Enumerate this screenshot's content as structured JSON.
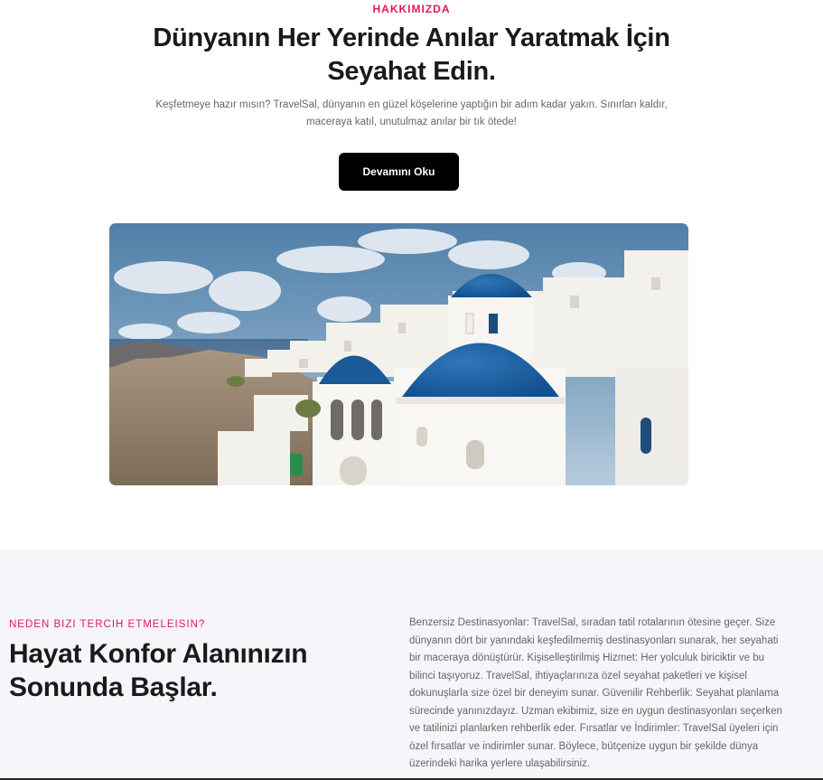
{
  "about": {
    "eyebrow": "HAKKIMIZDA",
    "headline": "Dünyanın Her Yerinde Anılar Yaratmak İçin Seyahat Edin.",
    "description": "Keşfetmeye hazır mısın? TravelSal, dünyanın en güzel köşelerine yaptığın bir adım kadar yakın. Sınırları kaldır, maceraya katıl, unutulmaz anılar bir tık ötede!",
    "cta_label": "Devamını Oku",
    "hero_icon": "santorini-photo"
  },
  "why": {
    "eyebrow": "NEDEN BIZI TERCIH ETMELEISIN?",
    "title": "Hayat Konfor Alanınızın Sonunda Başlar.",
    "body": "Benzersiz Destinasyonlar: TravelSal, sıradan tatil rotalarının ötesine geçer. Size dünyanın dört bir yanındaki keşfedilmemiş destinasyonları sunarak, her seyahati bir maceraya dönüştürür. Kişiselleştirilmiş Hizmet: Her yolculuk biriciktir ve bu bilinci taşıyoruz. TravelSal, ihtiyaçlarınıza özel seyahat paketleri ve kişisel dokunuşlarla size özel bir deneyim sunar. Güvenilir Rehberlik: Seyahat planlama sürecinde yanınızdayız. Uzman ekibimiz, size en uygun destinasyonları seçerken ve tatilinizi planlarken rehberlik eder. Fırsatlar ve İndirimler: TravelSal üyeleri için özel fırsatlar ve indirimler sunar. Böylece, bütçenize uygun bir şekilde dünya üzerindeki harika yerlere ulaşabilirsiniz."
  },
  "colors": {
    "accent": "#e0195b",
    "button": "#000000",
    "section_bg": "#f6f6fa"
  }
}
